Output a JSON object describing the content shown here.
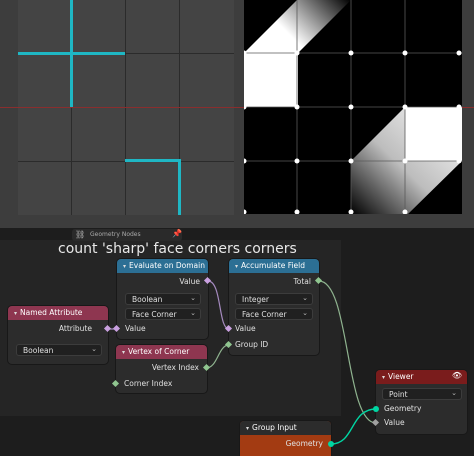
{
  "editor": {
    "type_label": "Geometry Nodes",
    "frame_title": "count 'sharp' face corners corners"
  },
  "nodes": {
    "named_attribute": {
      "title": "Named Attribute",
      "output_label": "Attribute",
      "type_value": "Boolean"
    },
    "evaluate_on_domain": {
      "title": "Evaluate on Domain",
      "output_label": "Value",
      "type_value": "Boolean",
      "domain_value": "Face Corner",
      "input_label": "Value"
    },
    "accumulate_field": {
      "title": "Accumulate Field",
      "output_label": "Total",
      "type_value": "Integer",
      "domain_value": "Face Corner",
      "input_value_label": "Value",
      "input_group_label": "Group ID"
    },
    "vertex_of_corner": {
      "title": "Vertex of Corner",
      "output_label": "Vertex Index",
      "input_label": "Corner Index"
    },
    "viewer": {
      "title": "Viewer",
      "domain_value": "Point",
      "input_geometry_label": "Geometry",
      "input_value_label": "Value",
      "eye_icon": "eye-icon"
    },
    "group_input": {
      "title": "Group Input",
      "output_label": "Geometry"
    }
  },
  "colors": {
    "seam": "#1fb7c4",
    "node_header_blue": "#2c6f94",
    "node_header_pink": "#8e3650",
    "node_header_red": "#7a1c1c",
    "node_header_orange": "#a33b12",
    "geometry_socket": "#00d6a3"
  }
}
